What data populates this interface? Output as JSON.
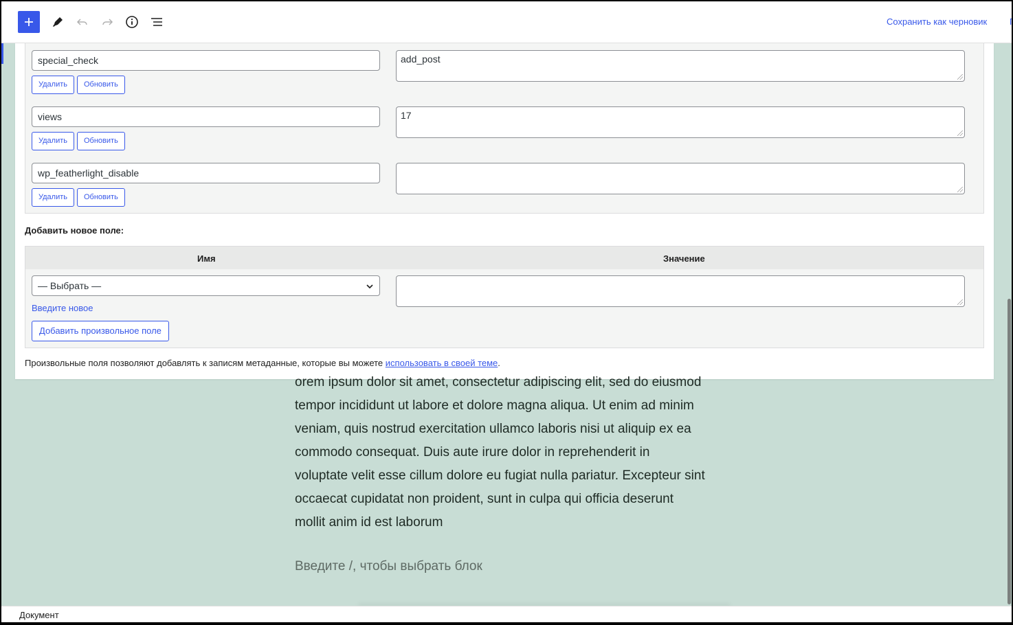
{
  "toolbar": {
    "add_icon": "plus-icon",
    "tools_icon": "pencil-icon",
    "undo_icon": "undo-icon",
    "redo_icon": "redo-icon",
    "details_icon": "info-icon",
    "list_view_icon": "list-view-icon",
    "save_draft_label": "Сохранить как черновик",
    "preview_label_partial": "П",
    "accent_color": "#3858e9"
  },
  "custom_fields": {
    "rows": [
      {
        "key": "special_check",
        "value": "add_post",
        "delete_label": "Удалить",
        "update_label": "Обновить"
      },
      {
        "key": "views",
        "value": "17",
        "delete_label": "Удалить",
        "update_label": "Обновить"
      },
      {
        "key": "wp_featherlight_disable",
        "value": "",
        "delete_label": "Удалить",
        "update_label": "Обновить"
      }
    ],
    "add_new_label": "Добавить новое поле:",
    "column_name": "Имя",
    "column_value": "Значение",
    "select_value": "— Выбрать —",
    "enter_new_link": "Введите новое",
    "add_button": "Добавить произвольное поле",
    "note_text": "Произвольные поля позволяют добавлять к записям метаданные, которые вы можете ",
    "note_link": "использовать в своей теме",
    "note_end": "."
  },
  "editor": {
    "paragraph_lines": [
      "orem ipsum dolor sit amet, consectetur adipiscing elit, sed do eiusmod",
      "tempor incididunt ut labore et dolore magna aliqua. Ut enim ad minim",
      "veniam, quis nostrud exercitation ullamco laboris nisi ut aliquip ex ea",
      "commodo consequat. Duis aute irure dolor in reprehenderit in",
      "voluptate velit esse cillum dolore eu fugiat nulla pariatur. Excepteur sint",
      "occaecat cupidatat non proident, sunt in culpa qui officia deserunt",
      "mollit anim id est laborum"
    ],
    "block_placeholder": "Введите /, чтобы выбрать блок",
    "background_color": "#c8ddd5"
  },
  "footer": {
    "breadcrumb": "Документ"
  }
}
